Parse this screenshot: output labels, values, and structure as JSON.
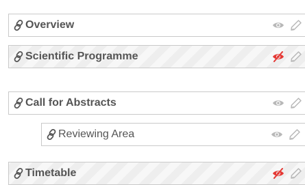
{
  "menu": {
    "entries": [
      {
        "title": "Overview",
        "visible": true,
        "level": 0
      },
      {
        "title": "Scientific Programme",
        "visible": false,
        "level": 0
      },
      {
        "title": "Call for Abstracts",
        "visible": true,
        "level": 0
      },
      {
        "title": "Reviewing Area",
        "visible": true,
        "level": 1
      },
      {
        "title": "Timetable",
        "visible": false,
        "level": 0
      }
    ]
  },
  "colors": {
    "text": "#555555",
    "border": "#c9c9c9",
    "hidden_eye": "#e53935",
    "visible_eye": "#b8b8b8",
    "disabled_bg": "#eeeeee"
  },
  "icons": {
    "link": "link-icon",
    "visible": "eye-icon",
    "hidden": "eye-slash-icon",
    "edit": "pencil-icon"
  }
}
